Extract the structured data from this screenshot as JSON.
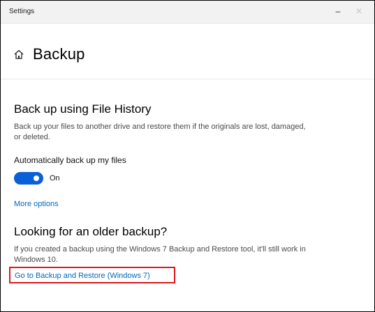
{
  "window": {
    "title": "Settings",
    "minimize_glyph": "–",
    "close_glyph": "✕"
  },
  "header": {
    "icon": "home-icon",
    "title": "Backup"
  },
  "file_history": {
    "heading": "Back up using File History",
    "description": "Back up your files to another drive and restore them if the originals are lost, damaged, or deleted.",
    "auto_backup_label": "Automatically back up my files",
    "toggle_state": "On",
    "toggle_on": true,
    "more_options": "More options"
  },
  "older_backup": {
    "heading": "Looking for an older backup?",
    "description": "If you created a backup using the Windows 7 Backup and Restore tool, it'll still work in Windows 10.",
    "link": "Go to Backup and Restore (Windows 7)"
  },
  "colors": {
    "accent": "#0a60d6",
    "link": "#0067c0",
    "highlight_box": "#e0161a"
  }
}
